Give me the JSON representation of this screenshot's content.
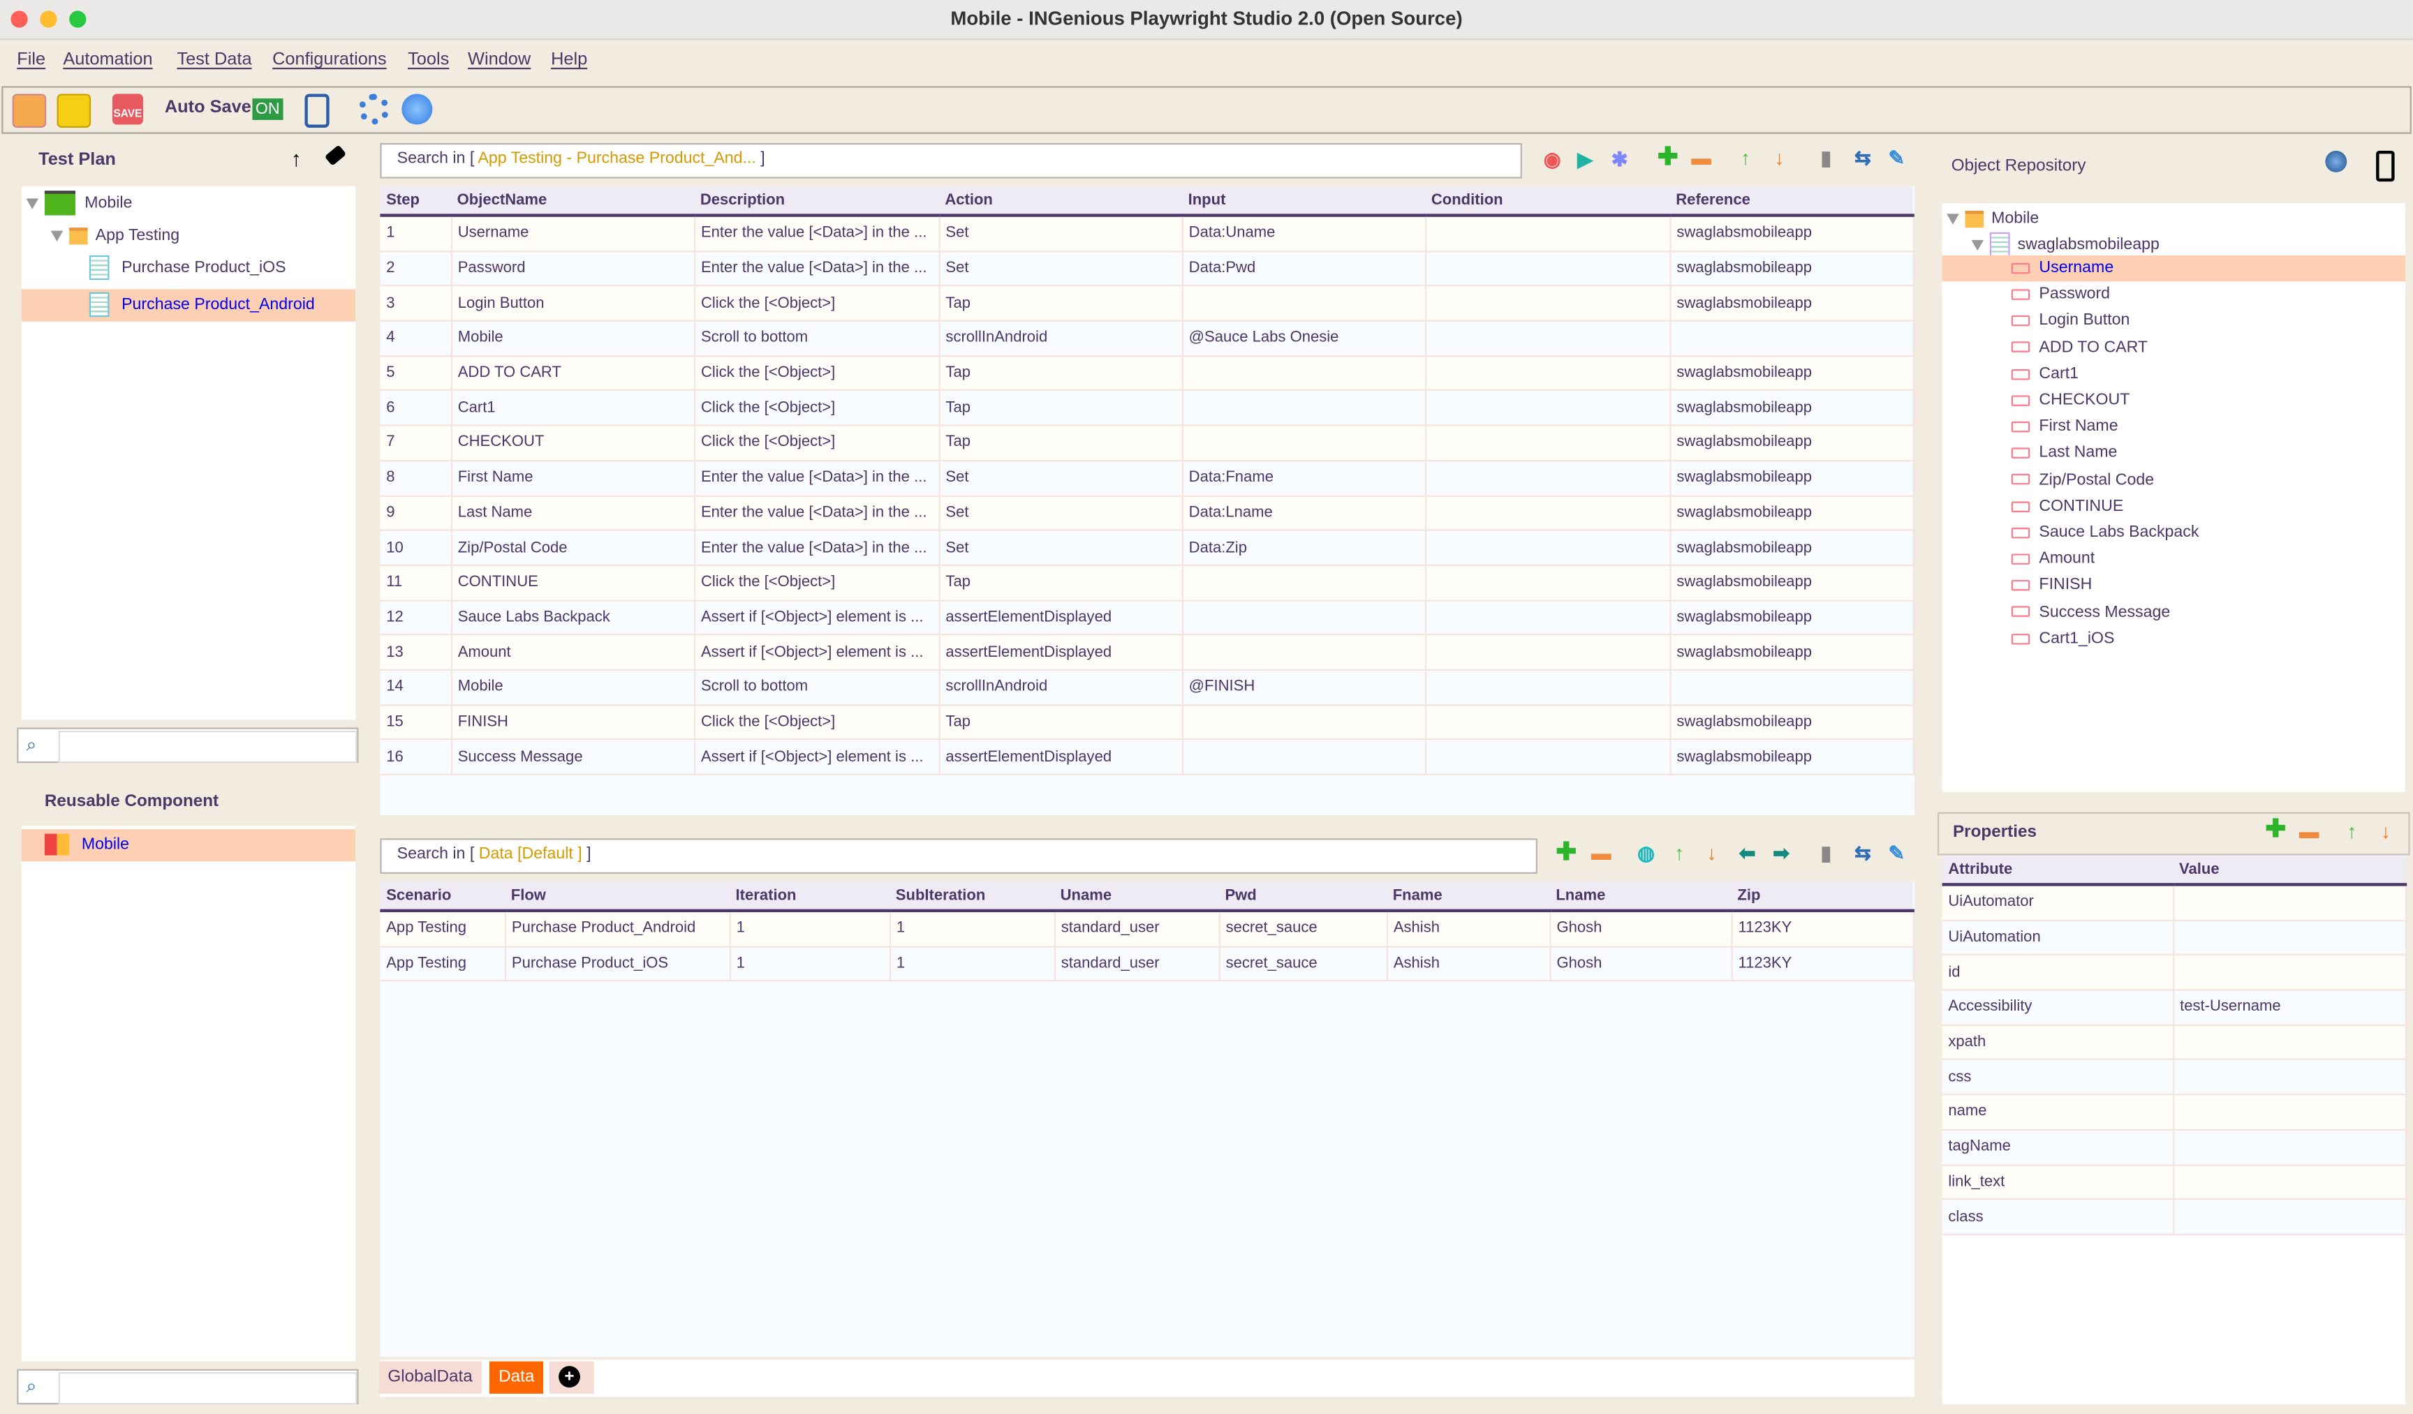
{
  "window": {
    "title": "Mobile - INGenious Playwright Studio 2.0 (Open Source)"
  },
  "menu": [
    "File",
    "Automation",
    "Test Data",
    "Configurations",
    "Tools",
    "Window",
    "Help"
  ],
  "toolbar": {
    "auto_save_label": "Auto Save",
    "auto_save_state": "ON",
    "icons": [
      "open-project-icon",
      "save-project-icon",
      "save-icon",
      "mobile-settings-icon",
      "settings-gear-icon",
      "browser-spy-icon"
    ]
  },
  "test_plan": {
    "title": "Test Plan",
    "tree": [
      {
        "label": "Mobile",
        "level": 0,
        "type": "project"
      },
      {
        "label": "App Testing",
        "level": 1,
        "type": "folder"
      },
      {
        "label": "Purchase Product_iOS",
        "level": 2,
        "type": "testcase"
      },
      {
        "label": "Purchase Product_Android",
        "level": 2,
        "type": "testcase",
        "selected": true
      }
    ],
    "search_value": ""
  },
  "reusable": {
    "title": "Reusable Component",
    "tree": [
      {
        "label": "Mobile",
        "selected": true
      }
    ],
    "search_value": ""
  },
  "steps": {
    "search_prefix": "Search in [ ",
    "search_scope": "App Testing - Purchase Product_And...",
    "search_suffix": " ]",
    "columns": [
      "Step",
      "ObjectName",
      "Description",
      "Action",
      "Input",
      "Condition",
      "Reference"
    ],
    "rows": [
      [
        "1",
        "Username",
        "Enter the value [<Data>] in the ...",
        "Set",
        "Data:Uname",
        "",
        "swaglabsmobileapp"
      ],
      [
        "2",
        "Password",
        "Enter the value [<Data>] in the ...",
        "Set",
        "Data:Pwd",
        "",
        "swaglabsmobileapp"
      ],
      [
        "3",
        "Login Button",
        "Click the [<Object>]",
        "Tap",
        "",
        "",
        "swaglabsmobileapp"
      ],
      [
        "4",
        "Mobile",
        "Scroll to bottom",
        "scrollInAndroid",
        "@Sauce Labs Onesie",
        "",
        ""
      ],
      [
        "5",
        "ADD TO CART",
        "Click the [<Object>]",
        "Tap",
        "",
        "",
        "swaglabsmobileapp"
      ],
      [
        "6",
        "Cart1",
        "Click the [<Object>]",
        "Tap",
        "",
        "",
        "swaglabsmobileapp"
      ],
      [
        "7",
        "CHECKOUT",
        "Click the [<Object>]",
        "Tap",
        "",
        "",
        "swaglabsmobileapp"
      ],
      [
        "8",
        "First Name",
        "Enter the value [<Data>] in the ...",
        "Set",
        "Data:Fname",
        "",
        "swaglabsmobileapp"
      ],
      [
        "9",
        "Last Name",
        "Enter the value [<Data>] in the ...",
        "Set",
        "Data:Lname",
        "",
        "swaglabsmobileapp"
      ],
      [
        "10",
        "Zip/Postal Code",
        "Enter the value [<Data>] in the ...",
        "Set",
        "Data:Zip",
        "",
        "swaglabsmobileapp"
      ],
      [
        "11",
        "CONTINUE",
        "Click the [<Object>]",
        "Tap",
        "",
        "",
        "swaglabsmobileapp"
      ],
      [
        "12",
        "Sauce Labs Backpack",
        "Assert if [<Object>] element is ...",
        "assertElementDisplayed",
        "",
        "",
        "swaglabsmobileapp"
      ],
      [
        "13",
        "Amount",
        "Assert if [<Object>] element is ...",
        "assertElementDisplayed",
        "",
        "",
        "swaglabsmobileapp"
      ],
      [
        "14",
        "Mobile",
        "Scroll to bottom",
        "scrollInAndroid",
        "@FINISH",
        "",
        ""
      ],
      [
        "15",
        "FINISH",
        "Click the [<Object>]",
        "Tap",
        "",
        "",
        "swaglabsmobileapp"
      ],
      [
        "16",
        "Success Message",
        "Assert if [<Object>] element is ...",
        "assertElementDisplayed",
        "",
        "",
        "swaglabsmobileapp"
      ]
    ]
  },
  "testdata": {
    "search_prefix": "Search in [ ",
    "search_scope": "Data [Default ]",
    "search_suffix": " ]",
    "columns": [
      "Scenario",
      "Flow",
      "Iteration",
      "SubIteration",
      "Uname",
      "Pwd",
      "Fname",
      "Lname",
      "Zip"
    ],
    "rows": [
      [
        "App Testing",
        "Purchase Product_Android",
        "1",
        "1",
        "standard_user",
        "secret_sauce",
        "Ashish",
        "Ghosh",
        "1123KY"
      ],
      [
        "App Testing",
        "Purchase Product_iOS",
        "1",
        "1",
        "standard_user",
        "secret_sauce",
        "Ashish",
        "Ghosh",
        "1123KY"
      ]
    ],
    "tabs": [
      {
        "label": "GlobalData",
        "active": false
      },
      {
        "label": "Data",
        "active": true
      }
    ]
  },
  "object_repository": {
    "title": "Object Repository",
    "root": "Mobile",
    "page": "swaglabsmobileapp",
    "selected": "Username",
    "objects": [
      "Username",
      "Password",
      "Login Button",
      "ADD TO CART",
      "Cart1",
      "CHECKOUT",
      "First Name",
      "Last Name",
      "Zip/Postal Code",
      "CONTINUE",
      "Sauce Labs Backpack",
      "Amount",
      "FINISH",
      "Success Message",
      "Cart1_iOS"
    ]
  },
  "properties": {
    "title": "Properties",
    "columns": [
      "Attribute",
      "Value"
    ],
    "rows": [
      [
        "UiAutomator",
        ""
      ],
      [
        "UiAutomation",
        ""
      ],
      [
        "id",
        ""
      ],
      [
        "Accessibility",
        "test-Username"
      ],
      [
        "xpath",
        ""
      ],
      [
        "css",
        ""
      ],
      [
        "name",
        ""
      ],
      [
        "tagName",
        ""
      ],
      [
        "link_text",
        ""
      ],
      [
        "class",
        ""
      ]
    ]
  },
  "colors": {
    "accent": "#ff6600",
    "selection": "#fdd0b3",
    "text": "#4b3768",
    "auto_save_on": "#2e9a44"
  }
}
